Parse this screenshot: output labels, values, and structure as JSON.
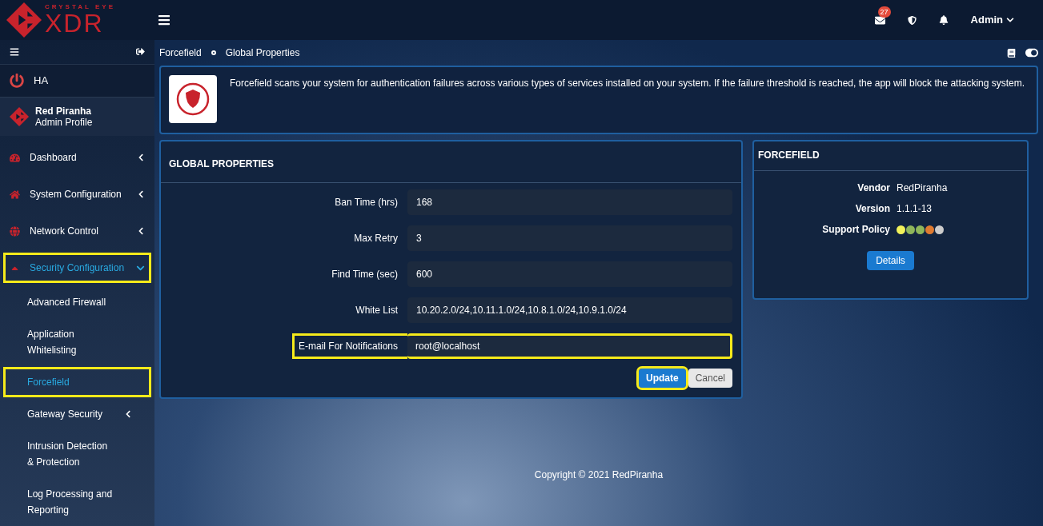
{
  "logo": {
    "tagline": "CRYSTAL EYE",
    "name": "XDR"
  },
  "header": {
    "mail_count": "27",
    "user": "Admin"
  },
  "sidebar": {
    "ha": "HA",
    "profile": {
      "name": "Red Piranha",
      "role": "Admin Profile"
    },
    "items": [
      {
        "label": "Dashboard",
        "kind": "section",
        "expanded": false,
        "selected": false,
        "highlighted": false
      },
      {
        "label": "System Configuration",
        "kind": "section",
        "expanded": false,
        "selected": false,
        "highlighted": false
      },
      {
        "label": "Network Control",
        "kind": "section",
        "expanded": false,
        "selected": false,
        "highlighted": false
      },
      {
        "label": "Security Configuration",
        "kind": "section",
        "expanded": true,
        "selected": true,
        "highlighted": true
      },
      {
        "label": "Advanced Firewall",
        "kind": "sub",
        "selected": false,
        "highlighted": false
      },
      {
        "label": "Application Whitelisting",
        "kind": "sub",
        "selected": false,
        "highlighted": false
      },
      {
        "label": "Forcefield",
        "kind": "sub",
        "selected": true,
        "highlighted": true
      },
      {
        "label": "Gateway Security",
        "kind": "subgroup",
        "expanded": false,
        "selected": false,
        "highlighted": false
      },
      {
        "label": "Intrusion Detection & Protection",
        "kind": "sub",
        "selected": false,
        "highlighted": false
      },
      {
        "label": "Log Processing and Reporting",
        "kind": "sub",
        "selected": false,
        "highlighted": false
      }
    ]
  },
  "breadcrumb": [
    "Forcefield",
    "Global Properties"
  ],
  "info": "Forcefield scans your system for authentication failures across various types of services installed on your system. If the failure threshold is reached, the app will block the attacking system.",
  "form": {
    "title": "GLOBAL PROPERTIES",
    "fields": [
      {
        "label": "Ban Time (hrs)",
        "value": "168",
        "highlighted": false
      },
      {
        "label": "Max Retry",
        "value": "3",
        "highlighted": false
      },
      {
        "label": "Find Time (sec)",
        "value": "600",
        "highlighted": false
      },
      {
        "label": "White List",
        "value": "10.20.2.0/24,10.11.1.0/24,10.8.1.0/24,10.9.1.0/24",
        "highlighted": false
      },
      {
        "label": "E-mail For Notifications",
        "value": "root@localhost",
        "highlighted": true
      }
    ],
    "buttons": [
      {
        "label": "Update",
        "kind": "primary",
        "highlighted": true
      },
      {
        "label": "Cancel",
        "kind": "secondary",
        "highlighted": false
      }
    ]
  },
  "app_card": {
    "title": "FORCEFIELD",
    "rows": [
      {
        "label": "Vendor",
        "value": "RedPiranha"
      },
      {
        "label": "Version",
        "value": "1.1.1-13"
      }
    ],
    "policy_label": "Support Policy",
    "policy_dots": [
      {
        "color": "#f2f25a"
      },
      {
        "color": "#8fb65a"
      },
      {
        "color": "#8fb65a"
      },
      {
        "color": "#e07b30"
      },
      {
        "color": "#cccccc"
      }
    ],
    "button": "Details"
  },
  "footer": "Copyright © 2021 RedPiranha"
}
